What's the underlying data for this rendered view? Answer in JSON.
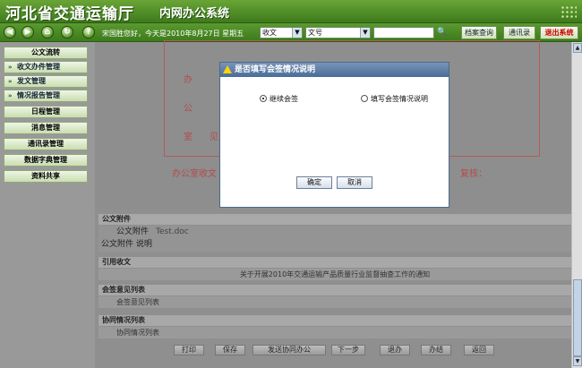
{
  "app": {
    "title_main": "河北省交通运输厅",
    "title_sub": "内网办公系统"
  },
  "toolbar": {
    "icons": [
      "back-icon",
      "forward-icon",
      "home-icon",
      "refresh-icon",
      "help-icon"
    ],
    "help_label": "?",
    "greeting": "宋国胜您好，今天是2010年8月27日 星期五",
    "type_select": "收文",
    "field_select": "文号",
    "search_value": "",
    "search_icon": "🔍",
    "archive_btn": "档案查询",
    "contacts_btn": "通讯录",
    "logout_btn": "退出系统"
  },
  "sidebar": {
    "items": [
      "公文流转",
      "收文办件管理",
      "发文管理",
      "情况报告管理",
      "日程管理",
      "消息管理",
      "通讯录管理",
      "数据字典管理",
      "资料共享"
    ]
  },
  "document": {
    "ban": "办",
    "gong": "公",
    "shi": "室",
    "jian": "见",
    "office_receipt": "办公室收文",
    "review": "复核："
  },
  "sections": {
    "attachments": "公文附件",
    "attachment_label": "公文附件",
    "attachment_file": "Test.doc",
    "attachment_desc": "公文附件 说明",
    "cited": "引用收文",
    "cited_item": "关于开展2010年交通运输产品质量行业监督抽查工作的通知",
    "opinions": "会签意见列表",
    "opinions_sub": "会签意见列表",
    "cooperation": "协同情况列表",
    "cooperation_sub": "协同情况列表"
  },
  "bottom_buttons": [
    "打印",
    "保存",
    "发送协同办公",
    "下一步",
    "退办",
    "办结",
    "返回"
  ],
  "dialog": {
    "title": "是否填写会签情况说明",
    "option1": "继续会签",
    "option2": "填写会签情况说明",
    "selected": "继续会签",
    "ok": "确定",
    "cancel": "取消"
  },
  "colors": {
    "banner": "#4d8a26",
    "dialog_title": "#5a7ca8",
    "logout": "#cc0000"
  }
}
